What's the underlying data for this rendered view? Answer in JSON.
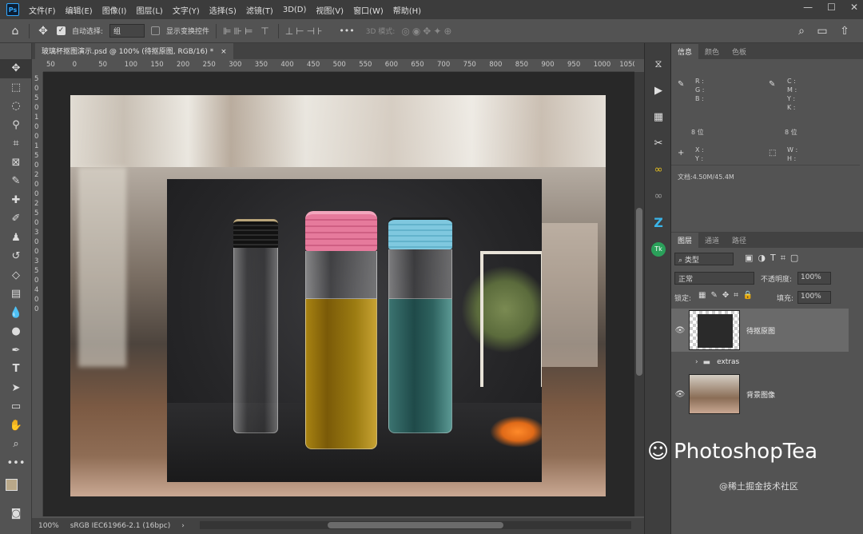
{
  "app": {
    "logo": "Ps"
  },
  "menu": [
    "文件(F)",
    "编辑(E)",
    "图像(I)",
    "图层(L)",
    "文字(Y)",
    "选择(S)",
    "滤镜(T)",
    "3D(D)",
    "视图(V)",
    "窗口(W)",
    "帮助(H)"
  ],
  "window_controls": [
    "—",
    "☐",
    "✕"
  ],
  "options": {
    "auto_select_label": "自动选择:",
    "auto_select_value": "组",
    "show_transform_label": "显示变换控件",
    "mode3d_label": "3D 模式:",
    "more": "•••"
  },
  "document": {
    "tab_title": "玻璃杯抠图演示.psd @ 100% (待抠原图, RGB/16) *",
    "close": "×",
    "ruler_ticks": [
      "50",
      "0",
      "50",
      "100",
      "150",
      "200",
      "250",
      "300",
      "350",
      "400",
      "450",
      "500",
      "550",
      "600",
      "650",
      "700",
      "750",
      "800",
      "850",
      "900",
      "950",
      "1000",
      "1050"
    ],
    "vruler_ticks": [
      "5",
      "0",
      "5",
      "0",
      "1",
      "0",
      "0",
      "1",
      "5",
      "0",
      "2",
      "0",
      "0",
      "2",
      "5",
      "0",
      "3",
      "0",
      "0",
      "3",
      "5",
      "0",
      "4",
      "0",
      "0"
    ]
  },
  "status": {
    "zoom": "100%",
    "profile": "sRGB IEC61966-2.1 (16bpc)"
  },
  "info_panel": {
    "tabs": [
      "信息",
      "颜色",
      "色板"
    ],
    "rgb_labels": "R :\nG :\nB :",
    "cmyk_labels": "C :\nM :\nY :\nK :",
    "bit_left": "8 位",
    "bit_right": "8 位",
    "xy": "X :\nY :",
    "wh": "W :\nH :",
    "doc_size": "文档:4.50M/45.4M"
  },
  "layers_panel": {
    "tabs": [
      "图层",
      "通道",
      "路径"
    ],
    "kind_filter": "类型",
    "blend_mode": "正常",
    "opacity_label": "不透明度:",
    "opacity_value": "100%",
    "lock_label": "锁定:",
    "fill_label": "填充:",
    "fill_value": "100%",
    "layers": [
      {
        "name": "待抠原图",
        "visible": true,
        "selected": true
      },
      {
        "name": "extras",
        "visible": false,
        "group": true
      },
      {
        "name": "背景图像",
        "visible": true
      }
    ]
  },
  "watermark": {
    "brand": "PhotoshopTea",
    "community": "@稀土掘金技术社区"
  }
}
